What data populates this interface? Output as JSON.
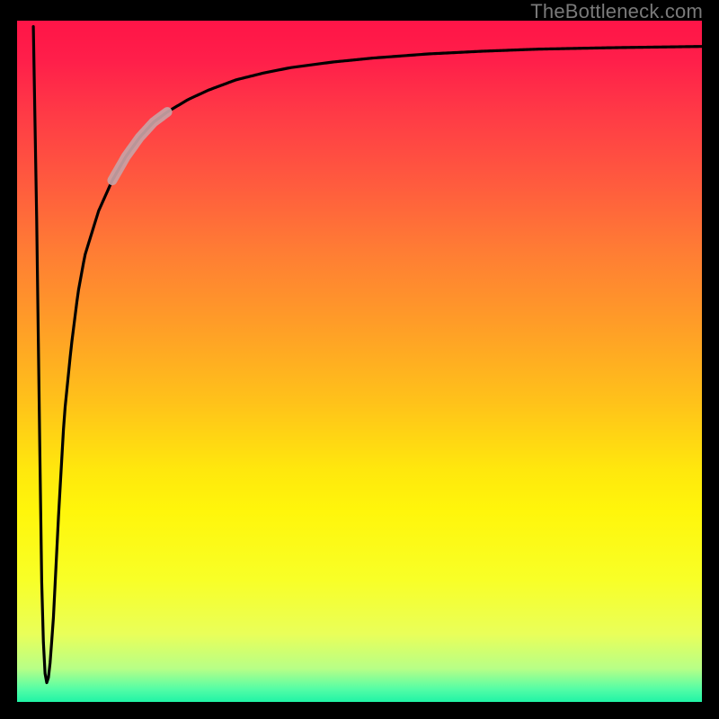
{
  "watermark": {
    "text": "TheBottleneck.com"
  },
  "colors": {
    "curve": "#000000",
    "highlight": "#c9a2a5",
    "frame": "#000000"
  },
  "chart_data": {
    "type": "line",
    "title": "",
    "xlabel": "",
    "ylabel": "",
    "xlim": [
      0,
      100
    ],
    "ylim": [
      0,
      100
    ],
    "grid": false,
    "legend": false,
    "annotations": [
      {
        "kind": "highlight_segment",
        "x_start": 14,
        "x_end": 22
      }
    ],
    "series": [
      {
        "name": "curve",
        "x": [
          2.5,
          3.0,
          3.4,
          3.8,
          4.3,
          4.8,
          5.4,
          6.2,
          7.0,
          8.0,
          9.0,
          10.0,
          12.0,
          14.0,
          16.0,
          18.0,
          20.0,
          22.0,
          25.0,
          28.0,
          32.0,
          36.0,
          40.0,
          46.0,
          52.0,
          60.0,
          68.0,
          76.0,
          86.0,
          100.0
        ],
        "y": [
          99.0,
          70.0,
          40.0,
          12.0,
          2.5,
          4.0,
          12.0,
          28.0,
          42.0,
          52.0,
          60.0,
          65.5,
          72.0,
          76.5,
          80.0,
          82.8,
          85.0,
          86.5,
          88.3,
          89.7,
          91.2,
          92.2,
          93.0,
          93.8,
          94.4,
          95.0,
          95.4,
          95.7,
          95.9,
          96.1
        ]
      }
    ]
  }
}
